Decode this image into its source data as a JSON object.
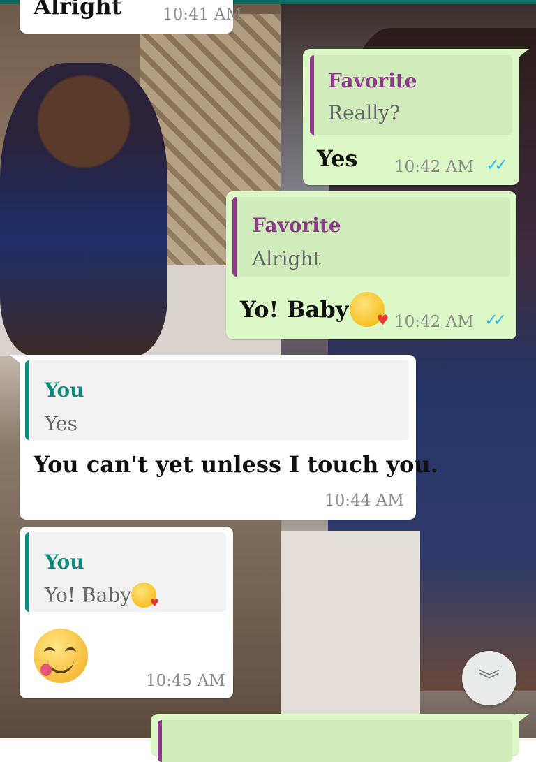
{
  "messages": [
    {
      "direction": "in",
      "text": "Alright",
      "time": "10:41 AM"
    },
    {
      "direction": "out",
      "reply_to": {
        "name": "Favorite",
        "text": "Really?"
      },
      "text": "Yes",
      "time": "10:42 AM",
      "status": "read"
    },
    {
      "direction": "out",
      "reply_to": {
        "name": "Favorite",
        "text": "Alright"
      },
      "text": "Yo! Baby",
      "emoji": "kissing-heart",
      "time": "10:42 AM",
      "status": "read"
    },
    {
      "direction": "in",
      "reply_to": {
        "name": "You",
        "text": "Yes"
      },
      "text": "You can't yet unless I touch you.",
      "time": "10:44 AM"
    },
    {
      "direction": "in",
      "reply_to": {
        "name": "You",
        "text": "Yo! Baby",
        "emoji": "kissing-heart"
      },
      "emoji": "yum-face",
      "time": "10:45 AM"
    }
  ],
  "scroll_button": {
    "icon": "double-chevron-down-icon"
  },
  "colors": {
    "outgoing_bubble": "#dcf8c6",
    "incoming_bubble": "#ffffff",
    "reply_name_favorite": "#8e3a8c",
    "reply_name_you": "#0d8a7b",
    "read_ticks": "#34b7f1",
    "header_strip": "#0b6b60"
  }
}
